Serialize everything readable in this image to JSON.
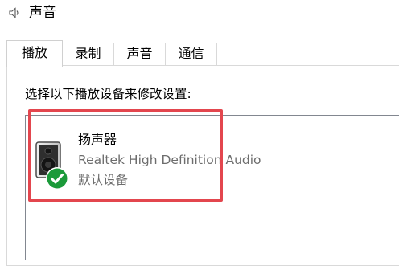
{
  "window": {
    "title": "声音",
    "icon": "speaker-icon"
  },
  "tabs": [
    {
      "label": "播放",
      "active": true
    },
    {
      "label": "录制",
      "active": false
    },
    {
      "label": "声音",
      "active": false
    },
    {
      "label": "通信",
      "active": false
    }
  ],
  "playback": {
    "instruction": "选择以下播放设备来修改设置:",
    "devices": [
      {
        "name": "扬声器",
        "driver": "Realtek High Definition Audio",
        "status": "默认设备",
        "icon": "speaker-icon",
        "badge_icon": "default-check-icon"
      }
    ]
  },
  "colors": {
    "highlight": "#e3464e",
    "check_green": "#1b9a3a",
    "secondary_text": "#6d6d6d"
  }
}
